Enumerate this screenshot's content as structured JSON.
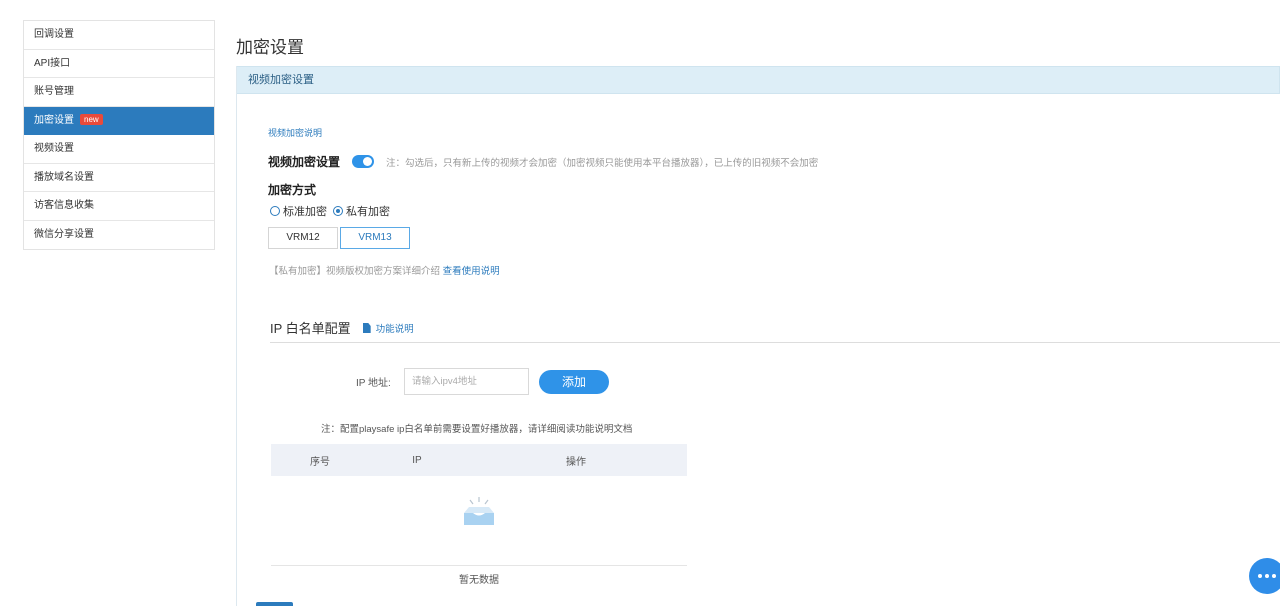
{
  "sidebar": {
    "items": [
      {
        "label": "回调设置"
      },
      {
        "label": "API接口"
      },
      {
        "label": "账号管理"
      },
      {
        "label": "加密设置",
        "badge": "new",
        "active": true
      },
      {
        "label": "视频设置"
      },
      {
        "label": "播放域名设置"
      },
      {
        "label": "访客信息收集"
      },
      {
        "label": "微信分享设置"
      }
    ]
  },
  "page": {
    "title": "加密设置"
  },
  "panel": {
    "header": "视频加密设置",
    "explain_link": "视频加密说明",
    "encryption_label": "视频加密设置",
    "encryption_on": true,
    "encryption_note": "注：勾选后，只有新上传的视频才会加密（加密视频只能使用本平台播放器），已上传的旧视频不会加密",
    "mode_title": "加密方式",
    "modes": [
      {
        "label": "标准加密",
        "checked": false
      },
      {
        "label": "私有加密",
        "checked": true
      }
    ],
    "vrm_tabs": [
      {
        "label": "VRM12",
        "active": false
      },
      {
        "label": "VRM13",
        "active": true
      }
    ],
    "vrm_note": "【私有加密】视频版权加密方案详细介绍",
    "vrm_note_link": "查看使用说明"
  },
  "ip_whitelist": {
    "title": "IP 白名单配置",
    "help_link": "功能说明",
    "form_label": "IP 地址:",
    "input_placeholder": "请输入ipv4地址",
    "add_button": "添加",
    "note": "注：配置playsafe ip白名单前需要设置好播放器，请详细阅读功能说明文档",
    "table": {
      "columns": [
        "序号",
        "IP",
        "操作"
      ],
      "empty_text": "暂无数据"
    }
  },
  "colors": {
    "accent": "#2c7bbd",
    "toggle": "#2f93e8",
    "header_bg": "#ddeef7",
    "badge": "#e94a3a"
  },
  "icons": {
    "help": "document-icon",
    "empty": "empty-box-icon",
    "chat": "chat-icon"
  }
}
